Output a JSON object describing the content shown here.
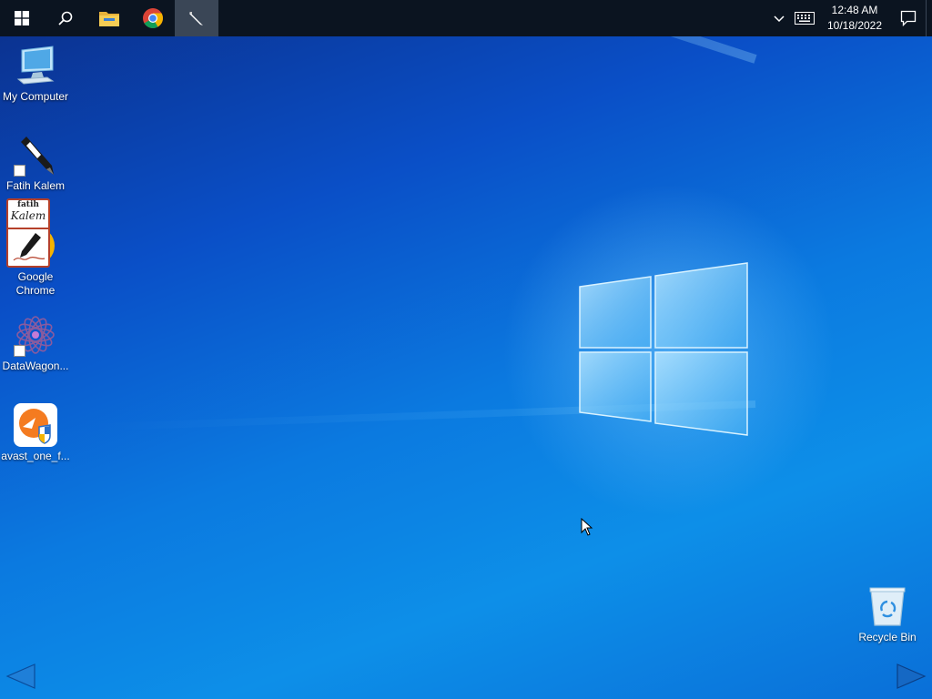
{
  "taskbar": {
    "start_label": "Start",
    "search_label": "Search",
    "pinned": [
      {
        "name": "file-explorer",
        "label": "File Explorer"
      },
      {
        "name": "google-chrome",
        "label": "Google Chrome"
      },
      {
        "name": "fatih-kalem",
        "label": "Fatih Kalem",
        "active": true
      }
    ],
    "clock": {
      "time": "12:48 AM",
      "date": "10/18/2022"
    }
  },
  "desktop": {
    "icons": [
      {
        "label": "My Computer"
      },
      {
        "label": "Fatih Kalem"
      },
      {
        "label": "Google Chrome"
      },
      {
        "label": "DataWagon..."
      },
      {
        "label": "avast_one_f..."
      },
      {
        "label": "Recycle Bin"
      }
    ],
    "floating_widget": {
      "line1": "fatih",
      "line2": "Kalem"
    }
  },
  "colors": {
    "taskbar_bg": "#0b1420",
    "desktop_accent": "#0a6fd8",
    "widget_border": "#b5402a"
  }
}
